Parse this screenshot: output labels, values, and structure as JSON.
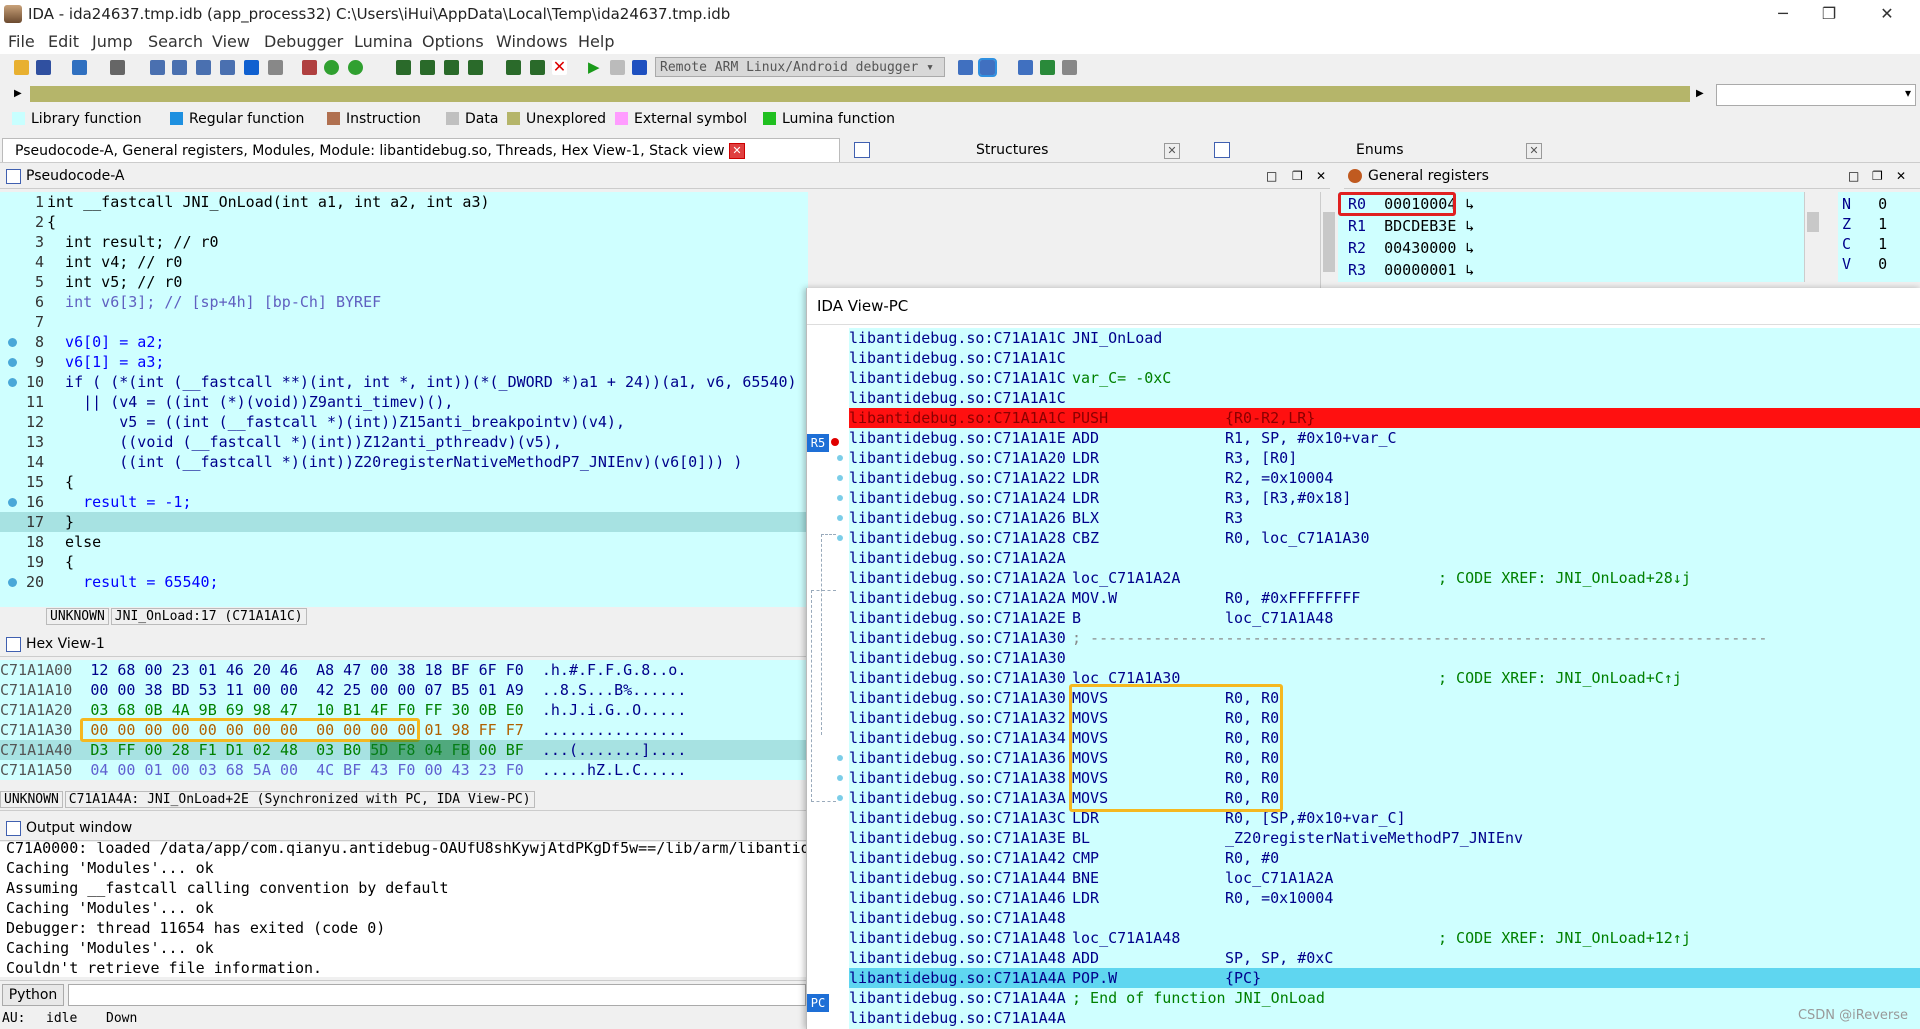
{
  "window": {
    "title": "IDA - ida24637.tmp.idb (app_process32) C:\\Users\\iHui\\AppData\\Local\\Temp\\ida24637.tmp.idb",
    "minimize": "─",
    "restore": "❐",
    "close": "✕"
  },
  "menu": [
    "File",
    "Edit",
    "Jump",
    "Search",
    "View",
    "Debugger",
    "Lumina",
    "Options",
    "Windows",
    "Help"
  ],
  "toolbar": {
    "debugger_select": "Remote ARM Linux/Android debugger"
  },
  "legend": [
    {
      "label": "Library function",
      "color": "#c8ffff"
    },
    {
      "label": "Regular function",
      "color": "#1e90e0"
    },
    {
      "label": "Instruction",
      "color": "#b07050"
    },
    {
      "label": "Data",
      "color": "#c0c0c0"
    },
    {
      "label": "Unexplored",
      "color": "#b5b56a"
    },
    {
      "label": "External symbol",
      "color": "#ff9cff"
    },
    {
      "label": "Lumina function",
      "color": "#20c020"
    }
  ],
  "tabs": {
    "main": "Pseudocode-A, General registers, Modules, Module: libantidebug.so, Threads, Hex View-1, Stack view",
    "structures": "Structures",
    "enums": "Enums"
  },
  "pseudocode": {
    "title": "Pseudocode-A",
    "lines": [
      {
        "n": "1",
        "t": "int __fastcall JNI_OnLoad(int a1, int a2, int a3)"
      },
      {
        "n": "2",
        "t": "{"
      },
      {
        "n": "3",
        "t": "  int result; // r0"
      },
      {
        "n": "4",
        "t": "  int v4; // r0"
      },
      {
        "n": "5",
        "t": "  int v5; // r0"
      },
      {
        "n": "6",
        "t": "  int v6[3]; // [sp+4h] [bp-Ch] BYREF"
      },
      {
        "n": "7",
        "t": ""
      },
      {
        "n": "8",
        "t": "  v6[0] = a2;"
      },
      {
        "n": "9",
        "t": "  v6[1] = a3;"
      },
      {
        "n": "10",
        "t": "  if ( (*(int (__fastcall **)(int, int *, int))(*(_DWORD *)a1 + 24))(a1, v6, 65540)"
      },
      {
        "n": "11",
        "t": "    || (v4 = ((int (*)(void))Z9anti_timev)(),"
      },
      {
        "n": "12",
        "t": "        v5 = ((int (__fastcall *)(int))Z15anti_breakpointv)(v4),"
      },
      {
        "n": "13",
        "t": "        ((void (__fastcall *)(int))Z12anti_pthreadv)(v5),"
      },
      {
        "n": "14",
        "t": "        ((int (__fastcall *)(int))Z20registerNativeMethodP7_JNIEnv)(v6[0])) )"
      },
      {
        "n": "15",
        "t": "  {"
      },
      {
        "n": "16",
        "t": "    result = -1;"
      },
      {
        "n": "17",
        "t": "  }"
      },
      {
        "n": "18",
        "t": "  else"
      },
      {
        "n": "19",
        "t": "  {"
      },
      {
        "n": "20",
        "t": "    result = 65540;"
      }
    ],
    "status_mode": "UNKNOWN",
    "status_loc": "JNI_OnLoad:17 (C71A1A1C)"
  },
  "hexview": {
    "title": "Hex View-1",
    "rows": [
      {
        "addr": "C71A1A00",
        "b1": "12 68 00 23 01 46 20 46",
        "b2": "A8 47 00 38 18 BF 6F F0",
        "asc": ".h.#.F.F.G.8..o."
      },
      {
        "addr": "C71A1A10",
        "b1": "00 00 38 BD 53 11 00 00",
        "b2": "42 25 00 00 07 B5 01 A9",
        "asc": "..8.S...B%......"
      },
      {
        "addr": "C71A1A20",
        "b1": "03 68 0B 4A 9B 69 98 47",
        "b2": "10 B1 4F F0 FF 30 0B E0",
        "asc": ".h.J.i.G..O....."
      },
      {
        "addr": "C71A1A30",
        "b1": "00 00 00 00 00 00 00 00",
        "b2": "00 00 00 00 01 98 FF F7",
        "asc": "................"
      },
      {
        "addr": "C71A1A40",
        "b1": "D3 FF 00 28 F1 D1 02 48",
        "b2": "03 B0 5D F8 04 FB 00 BF",
        "asc": "...(.......]...."
      },
      {
        "addr": "C71A1A50",
        "b1": "04 00 01 00 03 68 5A 00",
        "b2": "4C BF 43 F0 00 43 23 F0",
        "asc": ".....hZ.L.C....."
      }
    ],
    "status_mode": "UNKNOWN",
    "status_loc": "C71A1A4A: JNI_OnLoad+2E (Synchronized with PC, IDA View-PC)"
  },
  "output": {
    "title": "Output window",
    "lines": [
      "C71A0000: loaded /data/app/com.qianyu.antidebug-OAUfU8shKywjAtdPKgDf5w==/lib/arm/libantid",
      "Caching 'Modules'... ok",
      "Assuming __fastcall calling convention by default",
      "Caching 'Modules'... ok",
      "Debugger: thread 11654 has exited (code 0)",
      "Caching 'Modules'... ok",
      "Couldn't retrieve file information."
    ],
    "python_label": "Python"
  },
  "status": {
    "au": "AU:",
    "state": "idle",
    "dir": "Down"
  },
  "registers": {
    "title": "General registers",
    "rows": [
      {
        "r": "R0",
        "v": "00010004"
      },
      {
        "r": "R1",
        "v": "BDCDEB3E"
      },
      {
        "r": "R2",
        "v": "00430000"
      },
      {
        "r": "R3",
        "v": "00000001"
      }
    ],
    "flags": [
      {
        "f": "N",
        "v": "0"
      },
      {
        "f": "Z",
        "v": "1"
      },
      {
        "f": "C",
        "v": "1"
      },
      {
        "f": "V",
        "v": "0"
      }
    ]
  },
  "idaview": {
    "title": "IDA View-PC",
    "tag_r5": "R5",
    "tag_pc": "PC",
    "lines": [
      {
        "a": "libantidebug.so:C71A1A1C",
        "m": "JNI_OnLoad",
        "o": "",
        "c": "",
        "k": "label"
      },
      {
        "a": "libantidebug.so:C71A1A1C",
        "m": "",
        "o": "",
        "c": "",
        "k": ""
      },
      {
        "a": "libantidebug.so:C71A1A1C",
        "m": "var_C= -0xC",
        "o": "",
        "c": "",
        "k": "cmt"
      },
      {
        "a": "libantidebug.so:C71A1A1C",
        "m": "",
        "o": "",
        "c": "",
        "k": ""
      },
      {
        "a": "libantidebug.so:C71A1A1C",
        "m": "PUSH",
        "o": "{R0-R2,LR}",
        "c": "",
        "k": "red"
      },
      {
        "a": "libantidebug.so:C71A1A1E",
        "m": "ADD",
        "o": "R1, SP, #0x10+var_C",
        "c": "",
        "k": ""
      },
      {
        "a": "libantidebug.so:C71A1A20",
        "m": "LDR",
        "o": "R3, [R0]",
        "c": "",
        "k": ""
      },
      {
        "a": "libantidebug.so:C71A1A22",
        "m": "LDR",
        "o": "R2, =0x10004",
        "c": "",
        "k": ""
      },
      {
        "a": "libantidebug.so:C71A1A24",
        "m": "LDR",
        "o": "R3, [R3,#0x18]",
        "c": "",
        "k": ""
      },
      {
        "a": "libantidebug.so:C71A1A26",
        "m": "BLX",
        "o": "R3",
        "c": "",
        "k": ""
      },
      {
        "a": "libantidebug.so:C71A1A28",
        "m": "CBZ",
        "o": "R0, loc_C71A1A30",
        "c": "",
        "k": ""
      },
      {
        "a": "libantidebug.so:C71A1A2A",
        "m": "",
        "o": "",
        "c": "",
        "k": ""
      },
      {
        "a": "libantidebug.so:C71A1A2A",
        "m": "loc_C71A1A2A",
        "o": "",
        "c": "; CODE XREF: JNI_OnLoad+28↓j",
        "k": "label"
      },
      {
        "a": "libantidebug.so:C71A1A2A",
        "m": "MOV.W",
        "o": "R0, #0xFFFFFFFF",
        "c": "",
        "k": ""
      },
      {
        "a": "libantidebug.so:C71A1A2E",
        "m": "B",
        "o": "loc_C71A1A48",
        "c": "",
        "k": ""
      },
      {
        "a": "libantidebug.so:C71A1A30",
        "m": "; ---------------------------------------------------------------------------",
        "o": "",
        "c": "",
        "k": "cmt"
      },
      {
        "a": "libantidebug.so:C71A1A30",
        "m": "",
        "o": "",
        "c": "",
        "k": ""
      },
      {
        "a": "libantidebug.so:C71A1A30",
        "m": "loc_C71A1A30",
        "o": "",
        "c": "; CODE XREF: JNI_OnLoad+C↑j",
        "k": "label"
      },
      {
        "a": "libantidebug.so:C71A1A30",
        "m": "MOVS",
        "o": "R0, R0",
        "c": "",
        "k": ""
      },
      {
        "a": "libantidebug.so:C71A1A32",
        "m": "MOVS",
        "o": "R0, R0",
        "c": "",
        "k": ""
      },
      {
        "a": "libantidebug.so:C71A1A34",
        "m": "MOVS",
        "o": "R0, R0",
        "c": "",
        "k": ""
      },
      {
        "a": "libantidebug.so:C71A1A36",
        "m": "MOVS",
        "o": "R0, R0",
        "c": "",
        "k": ""
      },
      {
        "a": "libantidebug.so:C71A1A38",
        "m": "MOVS",
        "o": "R0, R0",
        "c": "",
        "k": ""
      },
      {
        "a": "libantidebug.so:C71A1A3A",
        "m": "MOVS",
        "o": "R0, R0",
        "c": "",
        "k": ""
      },
      {
        "a": "libantidebug.so:C71A1A3C",
        "m": "LDR",
        "o": "R0, [SP,#0x10+var_C]",
        "c": "",
        "k": ""
      },
      {
        "a": "libantidebug.so:C71A1A3E",
        "m": "BL",
        "o": "_Z20registerNativeMethodP7_JNIEnv",
        "c": "",
        "k": ""
      },
      {
        "a": "libantidebug.so:C71A1A42",
        "m": "CMP",
        "o": "R0, #0",
        "c": "",
        "k": ""
      },
      {
        "a": "libantidebug.so:C71A1A44",
        "m": "BNE",
        "o": "loc_C71A1A2A",
        "c": "",
        "k": ""
      },
      {
        "a": "libantidebug.so:C71A1A46",
        "m": "LDR",
        "o": "R0, =0x10004",
        "c": "",
        "k": ""
      },
      {
        "a": "libantidebug.so:C71A1A48",
        "m": "",
        "o": "",
        "c": "",
        "k": ""
      },
      {
        "a": "libantidebug.so:C71A1A48",
        "m": "loc_C71A1A48",
        "o": "",
        "c": "; CODE XREF: JNI_OnLoad+12↑j",
        "k": "label"
      },
      {
        "a": "libantidebug.so:C71A1A48",
        "m": "ADD",
        "o": "SP, SP, #0xC",
        "c": "",
        "k": ""
      },
      {
        "a": "libantidebug.so:C71A1A4A",
        "m": "POP.W",
        "o": "{PC}",
        "c": "",
        "k": "pc"
      },
      {
        "a": "libantidebug.so:C71A1A4A",
        "m": "; End of function JNI_OnLoad",
        "o": "",
        "c": "",
        "k": "cmt"
      },
      {
        "a": "libantidebug.so:C71A1A4A",
        "m": "",
        "o": "",
        "c": "",
        "k": ""
      }
    ]
  },
  "watermark": "CSDN @iReverse"
}
